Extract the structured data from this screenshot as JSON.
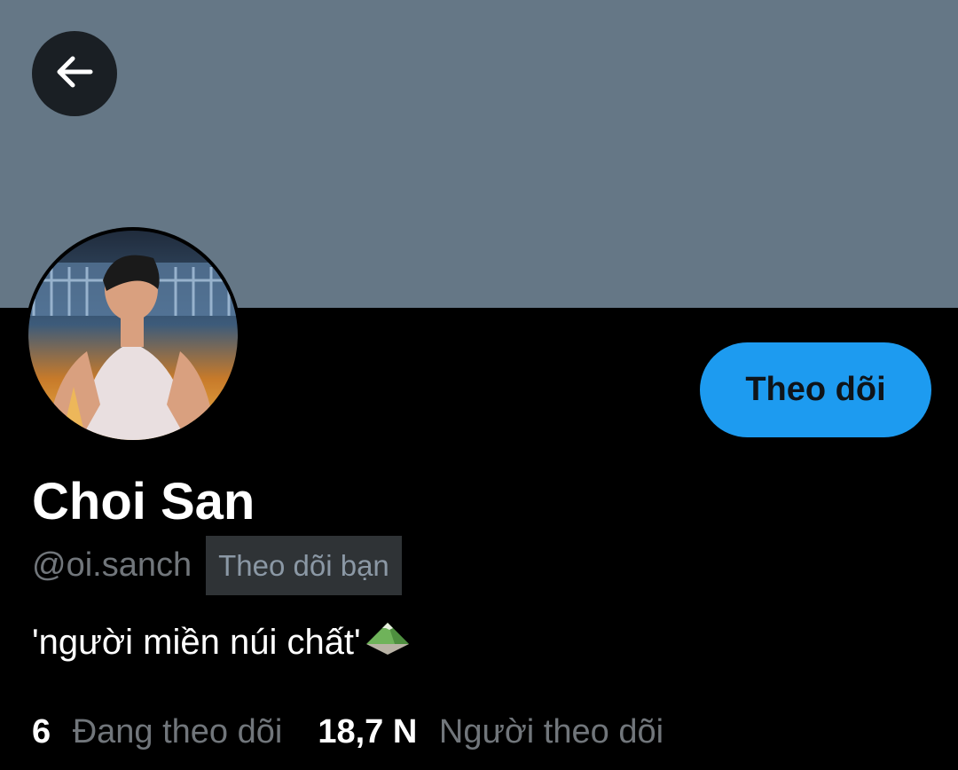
{
  "profile": {
    "display_name": "Choi San",
    "handle": "@oi.sanch",
    "follows_you_label": "Theo dõi bạn",
    "bio": "'người miền núi chất'",
    "bio_emoji": "mountain-icon",
    "follow_button_label": "Theo dõi"
  },
  "stats": {
    "following_count": "6",
    "following_label": "Đang theo dõi",
    "followers_count": "18,7 N",
    "followers_label": "Người theo dõi"
  },
  "colors": {
    "banner": "#657786",
    "background": "#000000",
    "accent": "#1d9bf0",
    "muted_text": "#71767b",
    "badge_bg": "#2f3336"
  },
  "icons": {
    "back": "arrow-left-icon"
  }
}
